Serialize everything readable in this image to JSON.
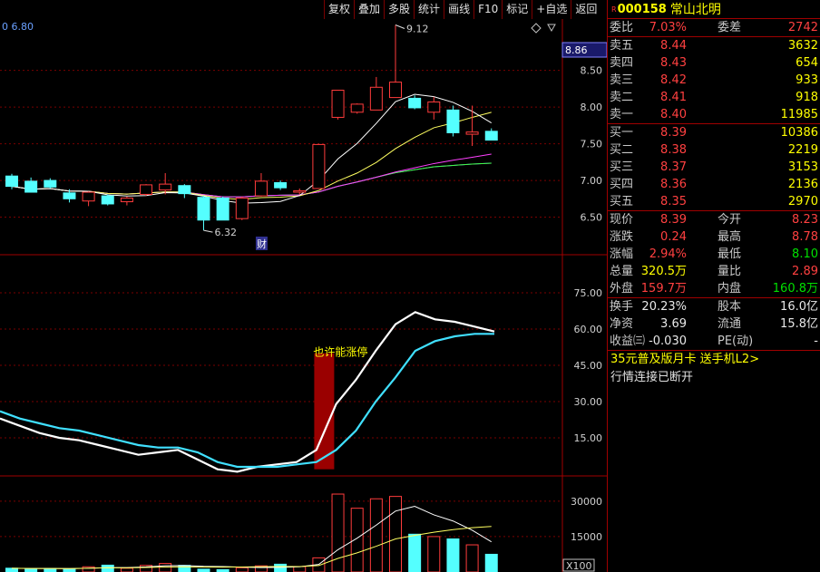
{
  "toolbar": {
    "items": [
      "复权",
      "叠加",
      "多股",
      "统计",
      "画线",
      "F10",
      "标记",
      "+自选",
      "返回"
    ]
  },
  "chart": {
    "ma_label": "0  6.80",
    "price_marker": "8.86",
    "high_label": "9.12",
    "low_label": "6.32",
    "fin_badge": "财",
    "annotation": "也许能涨停",
    "volume_unit": "X100",
    "price_ticks": [
      "8.50",
      "8.00",
      "7.50",
      "7.00",
      "6.50"
    ],
    "kdj_ticks": [
      "75.00",
      "60.00",
      "45.00",
      "30.00",
      "15.00"
    ],
    "vol_ticks": [
      "30000",
      "15000"
    ],
    "colors": {
      "up": "#ff3c3c",
      "down": "#54ffff",
      "grid": "#7a0000",
      "ma5": "#ffffff",
      "ma10": "#ffff60",
      "ma20": "#ff40ff",
      "ma30": "#40ff40",
      "ma60": "#6060ff"
    }
  },
  "chart_data": {
    "type": "candlestick",
    "candles": [
      {
        "o": 7.06,
        "h": 7.09,
        "l": 6.88,
        "c": 6.92
      },
      {
        "o": 6.99,
        "h": 7.04,
        "l": 6.84,
        "c": 6.84
      },
      {
        "o": 7.0,
        "h": 7.03,
        "l": 6.89,
        "c": 6.91
      },
      {
        "o": 6.83,
        "h": 6.88,
        "l": 6.7,
        "c": 6.75
      },
      {
        "o": 6.72,
        "h": 6.85,
        "l": 6.65,
        "c": 6.84
      },
      {
        "o": 6.79,
        "h": 6.81,
        "l": 6.66,
        "c": 6.68
      },
      {
        "o": 6.71,
        "h": 6.78,
        "l": 6.66,
        "c": 6.76
      },
      {
        "o": 6.81,
        "h": 6.95,
        "l": 6.79,
        "c": 6.94
      },
      {
        "o": 6.87,
        "h": 7.1,
        "l": 6.81,
        "c": 6.95
      },
      {
        "o": 6.93,
        "h": 6.95,
        "l": 6.76,
        "c": 6.82
      },
      {
        "o": 6.77,
        "h": 6.79,
        "l": 6.32,
        "c": 6.46
      },
      {
        "o": 6.76,
        "h": 6.78,
        "l": 6.46,
        "c": 6.46
      },
      {
        "o": 6.48,
        "h": 6.78,
        "l": 6.46,
        "c": 6.76
      },
      {
        "o": 6.79,
        "h": 7.1,
        "l": 6.78,
        "c": 6.99
      },
      {
        "o": 6.97,
        "h": 7.0,
        "l": 6.87,
        "c": 6.9
      },
      {
        "o": 6.84,
        "h": 6.89,
        "l": 6.81,
        "c": 6.86
      },
      {
        "o": 6.89,
        "h": 7.5,
        "l": 6.89,
        "c": 7.49
      },
      {
        "o": 7.86,
        "h": 8.23,
        "l": 7.83,
        "c": 8.23
      },
      {
        "o": 7.93,
        "h": 8.05,
        "l": 7.91,
        "c": 8.04
      },
      {
        "o": 7.96,
        "h": 8.41,
        "l": 7.96,
        "c": 8.27
      },
      {
        "o": 8.13,
        "h": 9.12,
        "l": 8.13,
        "c": 8.34
      },
      {
        "o": 8.12,
        "h": 8.16,
        "l": 7.97,
        "c": 7.99
      },
      {
        "o": 7.93,
        "h": 8.14,
        "l": 7.83,
        "c": 8.07
      },
      {
        "o": 7.96,
        "h": 8.02,
        "l": 7.6,
        "c": 7.65
      },
      {
        "o": 7.63,
        "h": 8.02,
        "l": 7.47,
        "c": 7.66
      },
      {
        "o": 7.67,
        "h": 7.71,
        "l": 7.55,
        "c": 7.55
      }
    ],
    "price_range": [
      6.0,
      9.2
    ],
    "indicator_range": [
      0,
      90
    ],
    "indicator_series": [
      {
        "values": [
          23,
          20,
          17,
          15,
          14,
          12,
          10,
          8,
          9,
          10,
          6,
          2,
          1,
          3,
          4,
          5,
          10,
          29,
          39,
          51,
          62,
          67,
          64,
          63,
          61,
          59
        ]
      },
      {
        "values": [
          26,
          23,
          21,
          19,
          18,
          16,
          14,
          12,
          11,
          11,
          9,
          5,
          3,
          3,
          3,
          4,
          5,
          10,
          18,
          30,
          40,
          51,
          55,
          57,
          58,
          58
        ]
      }
    ],
    "annotation_box": [
      2,
      50
    ],
    "volume_range": [
      0,
      38000
    ],
    "volumes": [
      1600,
      1400,
      1500,
      1200,
      2200,
      2900,
      1600,
      2800,
      3600,
      2800,
      1200,
      1000,
      1800,
      2600,
      3300,
      2300,
      6000,
      33000,
      27000,
      31000,
      32000,
      16000,
      15000,
      14000,
      11500,
      7500
    ]
  },
  "quote": {
    "code": "000158",
    "name": "常山北明",
    "committee_ratio_label": "委比",
    "committee_ratio": "7.03%",
    "committee_diff_label": "委差",
    "committee_diff": "2742",
    "asks": [
      {
        "label": "卖五",
        "price": "8.44",
        "vol": "3632"
      },
      {
        "label": "卖四",
        "price": "8.43",
        "vol": "654"
      },
      {
        "label": "卖三",
        "price": "8.42",
        "vol": "933"
      },
      {
        "label": "卖二",
        "price": "8.41",
        "vol": "918"
      },
      {
        "label": "卖一",
        "price": "8.40",
        "vol": "11985"
      }
    ],
    "bids": [
      {
        "label": "买一",
        "price": "8.39",
        "vol": "10386"
      },
      {
        "label": "买二",
        "price": "8.38",
        "vol": "2219"
      },
      {
        "label": "买三",
        "price": "8.37",
        "vol": "3153"
      },
      {
        "label": "买四",
        "price": "8.36",
        "vol": "2136"
      },
      {
        "label": "买五",
        "price": "8.35",
        "vol": "2970"
      }
    ],
    "stats": [
      {
        "l1": "现价",
        "v1": "8.39",
        "c1": "red",
        "l2": "今开",
        "v2": "8.23",
        "c2": "red"
      },
      {
        "l1": "涨跌",
        "v1": "0.24",
        "c1": "red",
        "l2": "最高",
        "v2": "8.78",
        "c2": "red"
      },
      {
        "l1": "涨幅",
        "v1": "2.94%",
        "c1": "red",
        "l2": "最低",
        "v2": "8.10",
        "c2": "grn"
      },
      {
        "l1": "总量",
        "v1": "320.5万",
        "c1": "yel",
        "l2": "量比",
        "v2": "2.89",
        "c2": "red"
      },
      {
        "l1": "外盘",
        "v1": "159.7万",
        "c1": "red",
        "l2": "内盘",
        "v2": "160.8万",
        "c2": "grn"
      }
    ],
    "stats2": [
      {
        "l1": "换手",
        "v1": "20.23%",
        "c1": "wht",
        "l2": "股本",
        "v2": "16.0亿",
        "c2": "wht"
      },
      {
        "l1": "净资",
        "v1": "3.69",
        "c1": "wht",
        "l2": "流通",
        "v2": "15.8亿",
        "c2": "wht"
      },
      {
        "l1": "收益㈢",
        "v1": "-0.030",
        "c1": "wht",
        "l2": "PE(动)",
        "v2": "-",
        "c2": "wht"
      }
    ],
    "promo": "35元普及版月卡 送手机L2>",
    "status": "行情连接已断开"
  }
}
